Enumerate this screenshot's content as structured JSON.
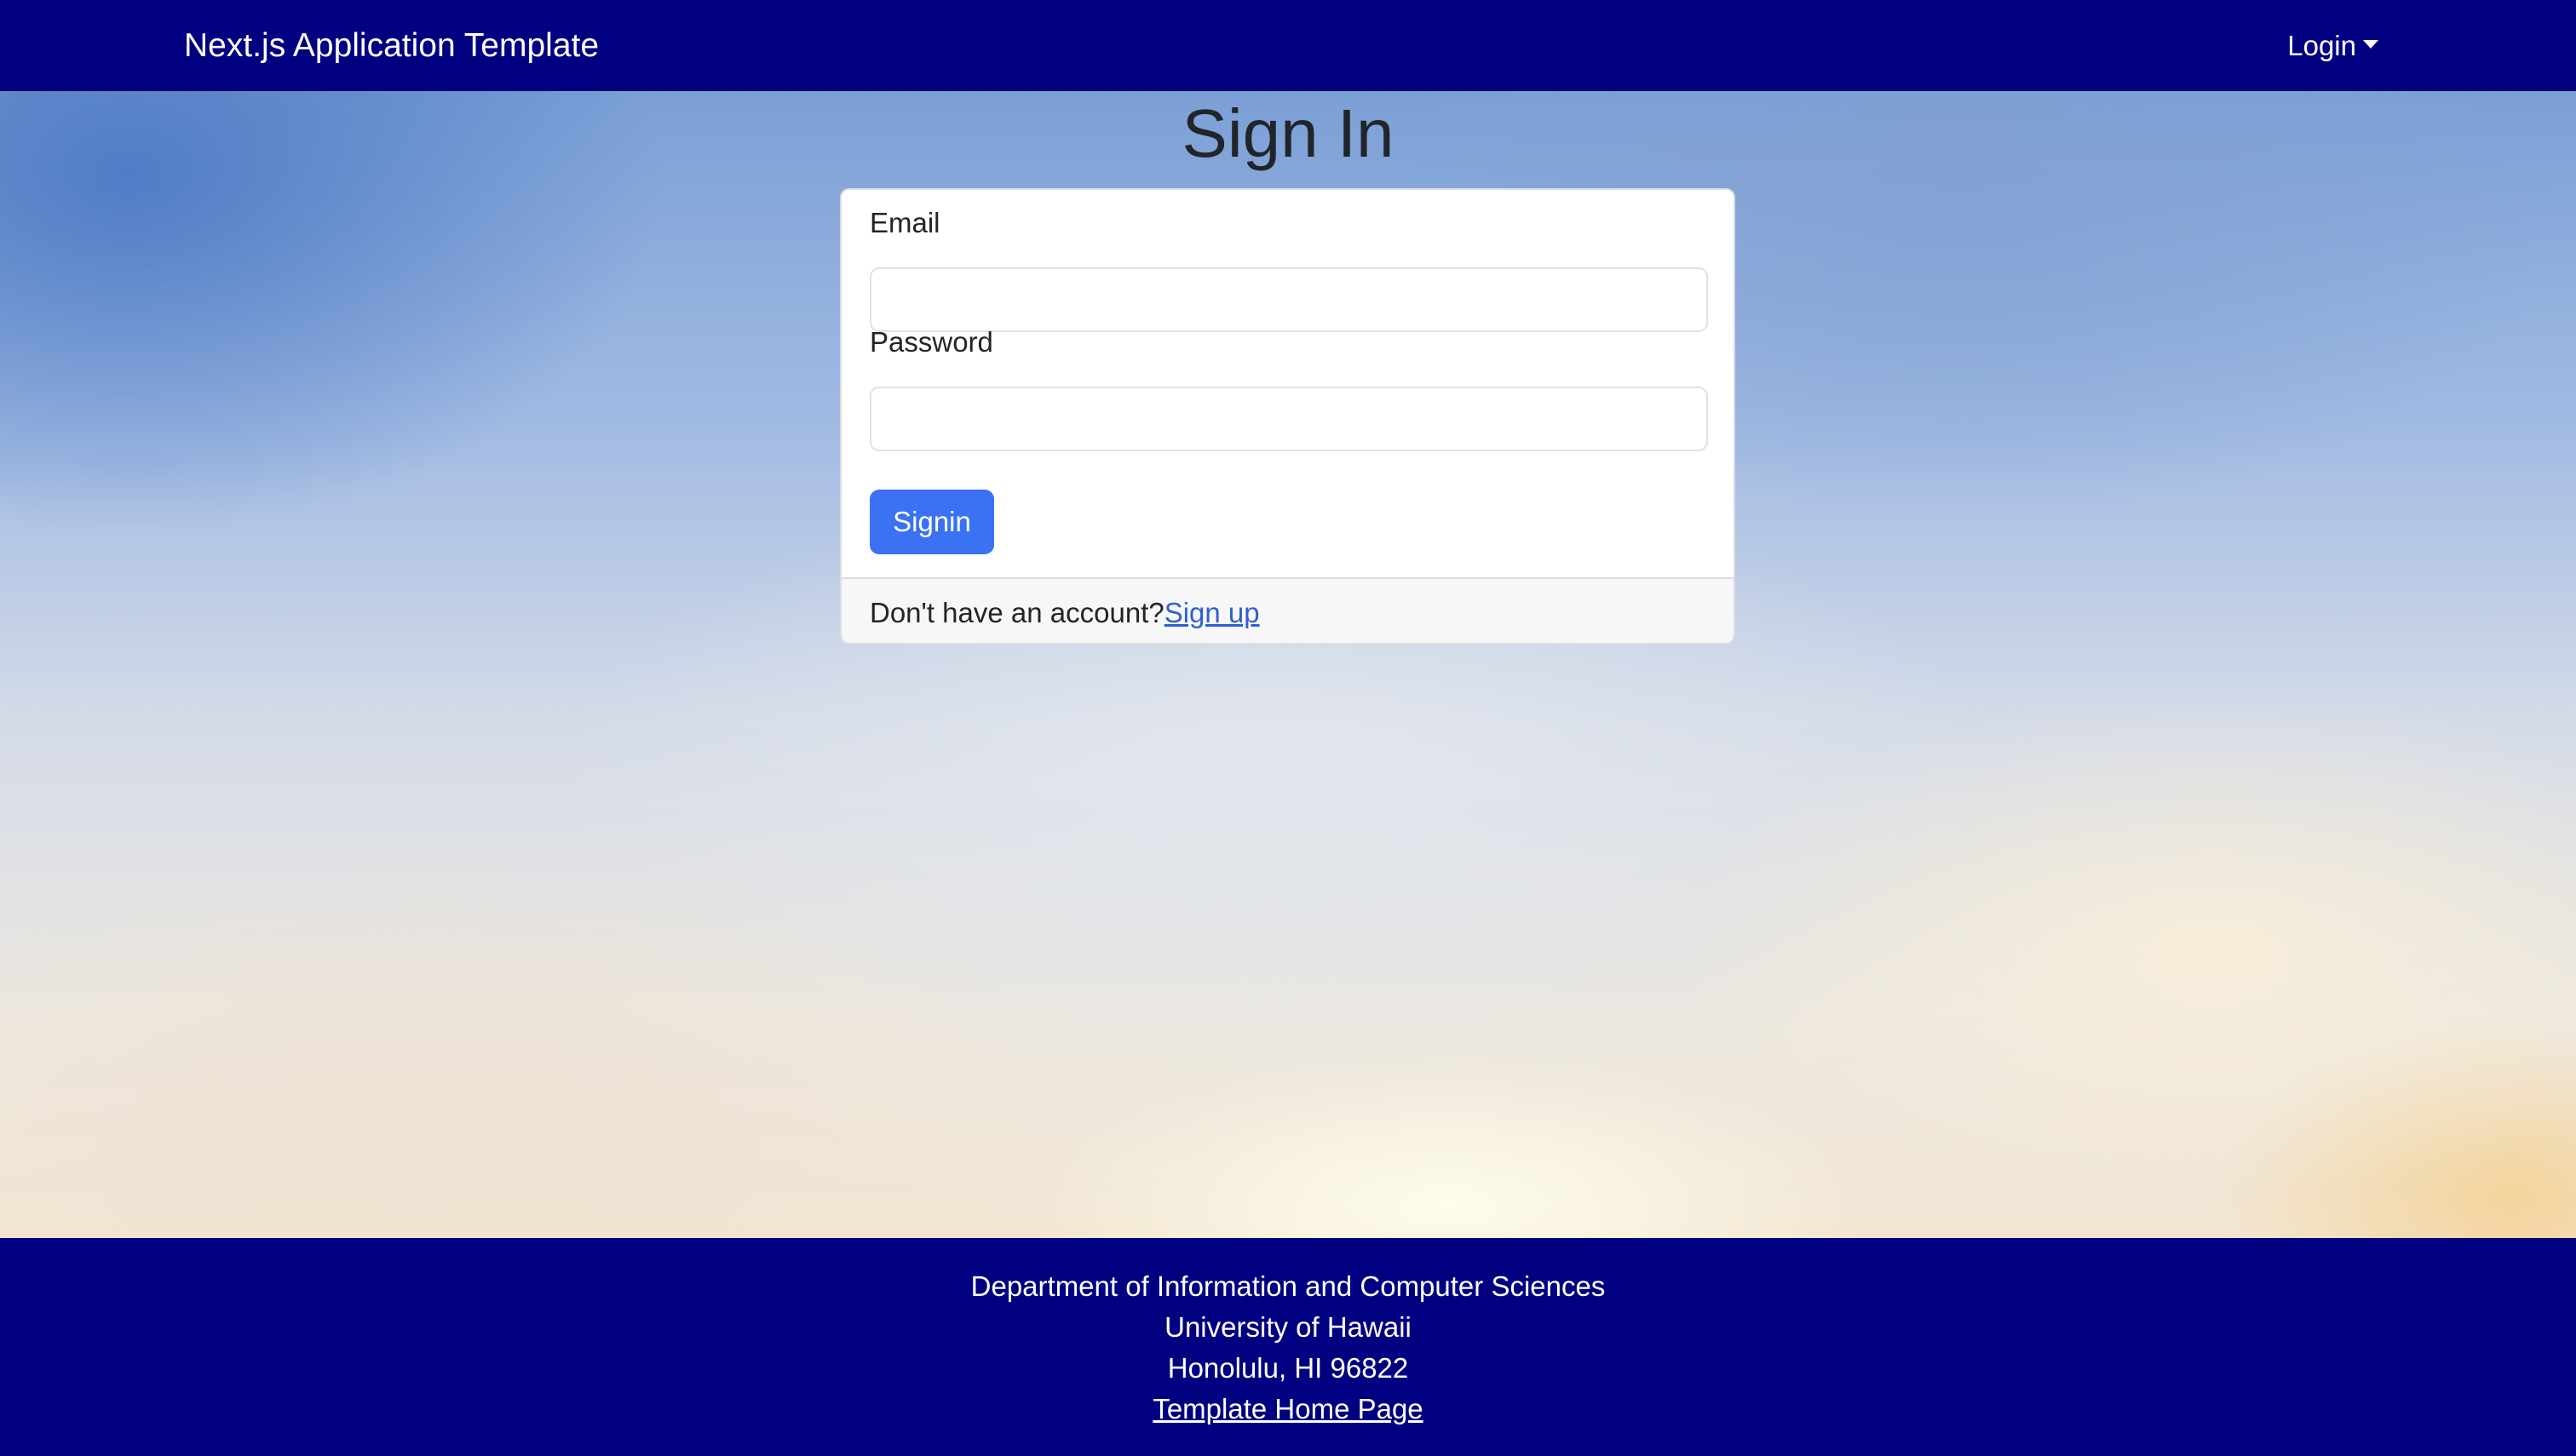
{
  "navbar": {
    "brand": "Next.js Application Template",
    "login_label": "Login"
  },
  "signin": {
    "title": "Sign In",
    "email_label": "Email",
    "email_value": "",
    "password_label": "Password",
    "password_value": "",
    "submit_label": "Signin",
    "footer_prompt": "Don't have an account?",
    "signup_label": "Sign up"
  },
  "footer": {
    "line1": "Department of Information and Computer Sciences",
    "line2": "University of Hawaii",
    "line3": "Honolulu, HI 96822",
    "link_label": "Template Home Page"
  },
  "colors": {
    "navbar_bg": "#000080",
    "primary_button": "#3b71f3",
    "link": "#2f5fd3"
  },
  "icons": {
    "login_dropdown": "caret-down-icon"
  }
}
